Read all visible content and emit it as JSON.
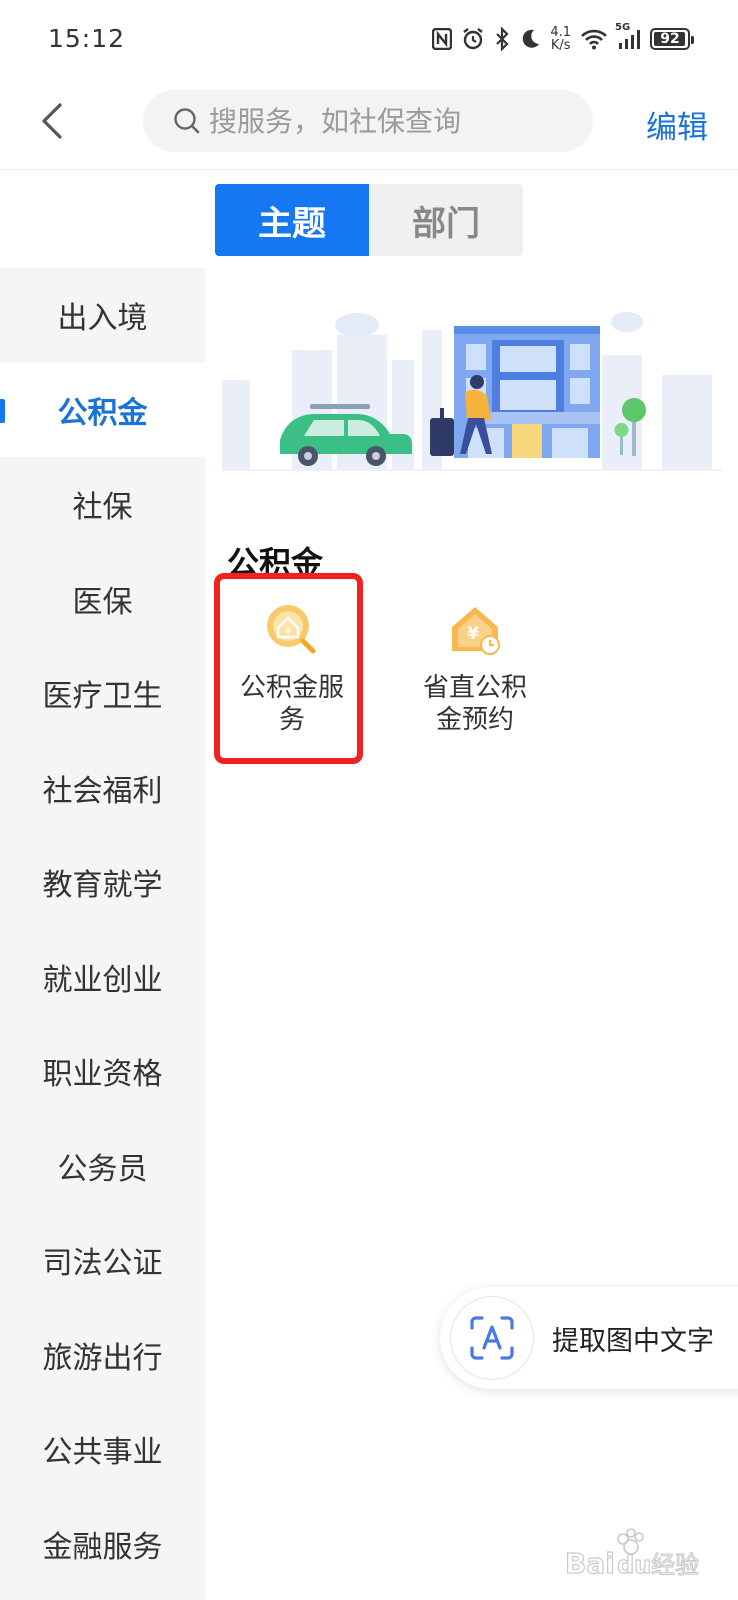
{
  "status": {
    "time": "15:12",
    "net_speed_value": "4.1",
    "net_speed_unit": "K/s",
    "network_type": "5G",
    "battery": "92"
  },
  "header": {
    "search_placeholder": "搜服务，如社保查询",
    "edit_label": "编辑"
  },
  "tabs": [
    {
      "label": "主题",
      "active": true
    },
    {
      "label": "部门",
      "active": false
    }
  ],
  "sidebar": {
    "items": [
      {
        "label": "出入境",
        "active": false
      },
      {
        "label": "公积金",
        "active": true
      },
      {
        "label": "社保",
        "active": false
      },
      {
        "label": "医保",
        "active": false
      },
      {
        "label": "医疗卫生",
        "active": false
      },
      {
        "label": "社会福利",
        "active": false
      },
      {
        "label": "教育就学",
        "active": false
      },
      {
        "label": "就业创业",
        "active": false
      },
      {
        "label": "职业资格",
        "active": false
      },
      {
        "label": "公务员",
        "active": false
      },
      {
        "label": "司法公证",
        "active": false
      },
      {
        "label": "旅游出行",
        "active": false
      },
      {
        "label": "公共事业",
        "active": false
      },
      {
        "label": "金融服务",
        "active": false
      }
    ]
  },
  "section": {
    "title": "公积金",
    "services": [
      {
        "label": "公积金服务",
        "icon": "housing-fund-search-icon",
        "highlighted": true
      },
      {
        "label": "省直公积金预约",
        "icon": "housing-fund-appointment-icon",
        "highlighted": false
      }
    ]
  },
  "float_button": {
    "label": "提取图中文字",
    "icon": "text-recognition-icon"
  },
  "watermark": {
    "text": "Baidu经验"
  },
  "colors": {
    "accent": "#1677f2",
    "highlight": "#f32020",
    "sidebar_bg": "#f5f5f5",
    "icon_gold": "#f5b83d"
  }
}
